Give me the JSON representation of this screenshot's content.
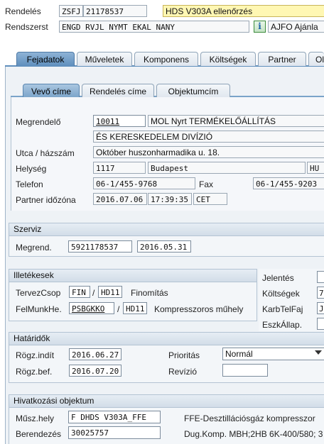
{
  "header": {
    "rendeles_label": "Rendelés",
    "rendeles_type": "ZSFJ",
    "rendeles_number": "21178537",
    "rendeles_desc": "HDS V303A ellenőrzés",
    "rendszerst_label": "Rendszerst",
    "rendszerst_value": "ENGD RVJL NYMT EKAL NANY",
    "info_icon_glyph": "i",
    "status_text": "AJFO Ajánla"
  },
  "main_tabs": [
    "Fejadatok",
    "Műveletek",
    "Komponens",
    "Költségek",
    "Partner",
    "Ol"
  ],
  "sub_tabs": [
    "Vevő címe",
    "Rendelés címe",
    "Objektumcím"
  ],
  "customer": {
    "megrendelo_label": "Megrendelő",
    "megrendelo_id": "10011",
    "name1": "MOL Nyrt TERMÉKELŐÁLLÍTÁS",
    "name2": "ÉS KERESKEDELEM DIVÍZIÓ",
    "street_label": "Utca / házszám",
    "street": "Október huszonharmadika u. 18.",
    "city_label": "Helység",
    "postal": "1117",
    "city": "Budapest",
    "country": "HU",
    "phone_label": "Telefon",
    "phone": "06-1/455-9768",
    "fax_label": "Fax",
    "fax": "06-1/455-9203",
    "tz_label": "Partner időzóna",
    "tz_date": "2016.07.06",
    "tz_time": "17:39:35",
    "tz_zone": "CET"
  },
  "szerviz": {
    "title": "Szerviz",
    "megrend_label": "Megrend.",
    "megrend_value": "5921178537",
    "megrend_date": "2016.05.31"
  },
  "illetekesek": {
    "title": "Illetékesek",
    "tervez_label": "TervezCsop",
    "tervez_code": "FIN",
    "tervez_slash": "/",
    "tervez_plant": "HD11",
    "tervez_desc": "Finomítás",
    "felmunk_label": "FelMunkHe.",
    "felmunk_code": "PSBGKKO",
    "felmunk_slash": "/",
    "felmunk_plant": "HD11",
    "felmunk_desc": "Kompresszoros műhely"
  },
  "right_panel": {
    "jelentes_label": "Jelentés",
    "jelentes_value": "",
    "koltsegek_label": "Költségek",
    "koltsegek_value": "7",
    "karbtelfaj_label": "KarbTelFaj",
    "karbtelfaj_value": "J",
    "eszkallap_label": "EszkÁllap.",
    "eszkallap_value": ""
  },
  "hataridok": {
    "title": "Határidők",
    "rogz_indit_label": "Rögz.indít",
    "rogz_indit_value": "2016.06.27",
    "rogz_bef_label": "Rögz.bef.",
    "rogz_bef_value": "2016.07.20",
    "prioritas_label": "Prioritás",
    "prioritas_value": "Normál",
    "revizio_label": "Revízió",
    "revizio_value": ""
  },
  "hivatkozasi": {
    "title": "Hivatkozási objektum",
    "muszhely_label": "Műsz.hely",
    "muszhely_value": "F DHDS V303A_FFE",
    "muszhely_desc": "FFE-Desztillációsgáz kompresszor",
    "berendezes_label": "Berendezés",
    "berendezes_value": "30025757",
    "berendezes_desc": "Dug.Komp. MBH;2HB 6K-400/580; 3"
  }
}
